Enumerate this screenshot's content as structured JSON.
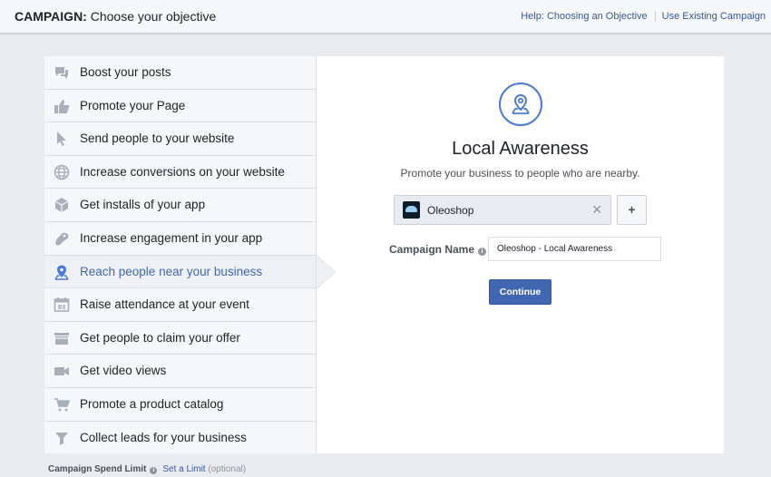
{
  "header": {
    "title_bold": "CAMPAIGN:",
    "title_rest": " Choose your objective",
    "help_link": "Help: Choosing an Objective",
    "existing_link": "Use Existing Campaign"
  },
  "objectives": [
    {
      "label": "Boost your posts",
      "icon": "posts-icon",
      "active": false
    },
    {
      "label": "Promote your Page",
      "icon": "thumbs-up-icon",
      "active": false
    },
    {
      "label": "Send people to your website",
      "icon": "cursor-icon",
      "active": false
    },
    {
      "label": "Increase conversions on your website",
      "icon": "globe-icon",
      "active": false
    },
    {
      "label": "Get installs of your app",
      "icon": "box-icon",
      "active": false
    },
    {
      "label": "Increase engagement in your app",
      "icon": "gamepad-icon",
      "active": false
    },
    {
      "label": "Reach people near your business",
      "icon": "map-pin-icon",
      "active": true
    },
    {
      "label": "Raise attendance at your event",
      "icon": "calendar-icon",
      "active": false
    },
    {
      "label": "Get people to claim your offer",
      "icon": "offer-icon",
      "active": false
    },
    {
      "label": "Get video views",
      "icon": "video-camera-icon",
      "active": false
    },
    {
      "label": "Promote a product catalog",
      "icon": "shopping-cart-icon",
      "active": false
    },
    {
      "label": "Collect leads for your business",
      "icon": "funnel-icon",
      "active": false
    }
  ],
  "detail": {
    "icon": "map-pin-icon",
    "title": "Local Awareness",
    "subtitle": "Promote your business to people who are nearby.",
    "page_name": "Oleoshop",
    "clear_symbol": "✕",
    "add_symbol": "+",
    "campaign_name_label": "Campaign Name",
    "campaign_name_value": "Oleoshop - Local Awareness",
    "continue_label": "Continue"
  },
  "footer": {
    "spend_label": "Campaign Spend Limit",
    "set_limit_link": "Set a Limit",
    "optional": "(optional)"
  },
  "colors": {
    "accent": "#4267b2",
    "icon_gray": "#a9afba",
    "pin_blue": "#4a7bd9"
  }
}
